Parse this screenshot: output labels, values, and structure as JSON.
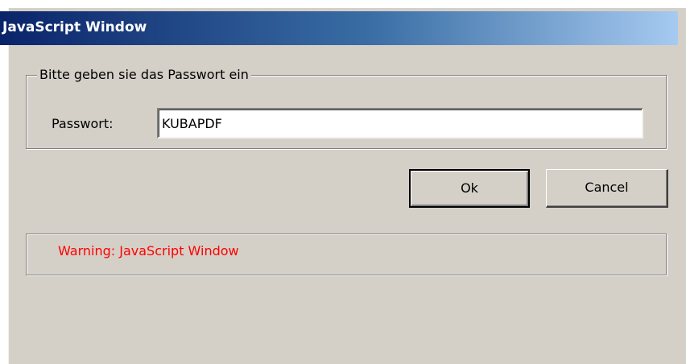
{
  "window": {
    "title": "JavaScript Window"
  },
  "password_group": {
    "legend": "Bitte geben sie das Passwort ein",
    "label": "Passwort:",
    "value": "KUBAPDF"
  },
  "buttons": {
    "ok_label": "Ok",
    "cancel_label": "Cancel"
  },
  "warning": {
    "text": "Warning: JavaScript Window",
    "color": "#ff0000"
  },
  "colors": {
    "dialog_background": "#d4d0c8",
    "titlebar_start": "#0a246a",
    "titlebar_end": "#a6caf0"
  }
}
